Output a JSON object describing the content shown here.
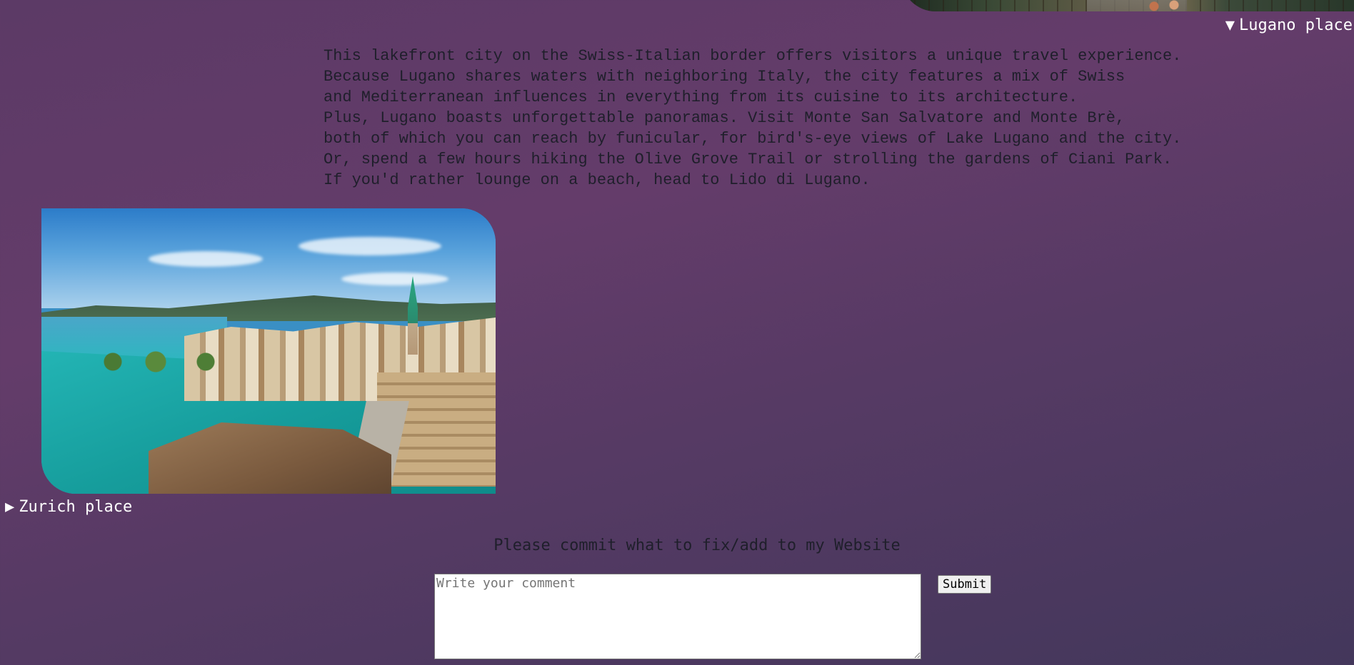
{
  "lugano": {
    "summary": "Lugano place",
    "expanded_marker": "▼",
    "text_lines": [
      "This lakefront city on the Swiss-Italian border offers visitors a unique travel experience.",
      "Because Lugano shares waters with neighboring Italy, the city features a mix of Swiss",
      "and Mediterranean influences in everything from its cuisine to its architecture.",
      "Plus, Lugano boasts unforgettable panoramas. Visit Monte San Salvatore and Monte Brè,",
      "both of which you can reach by funicular, for bird's-eye views of Lake Lugano and the city.",
      "Or, spend a few hours hiking the Olive Grove Trail or strolling the gardens of Ciani Park.",
      "If you'd rather lounge on a beach, head to Lido di Lugano."
    ]
  },
  "zurich": {
    "summary": "Zurich place",
    "collapsed_marker": "▶"
  },
  "comment": {
    "heading": "Please commit what to fix/add to my Website",
    "placeholder": "Write your comment",
    "submit_label": "Submit"
  },
  "colors": {
    "background_top": "#643c6a",
    "background_bottom": "#43375b",
    "summary_text": "#ffffff",
    "body_text": "#1f1f2b"
  }
}
